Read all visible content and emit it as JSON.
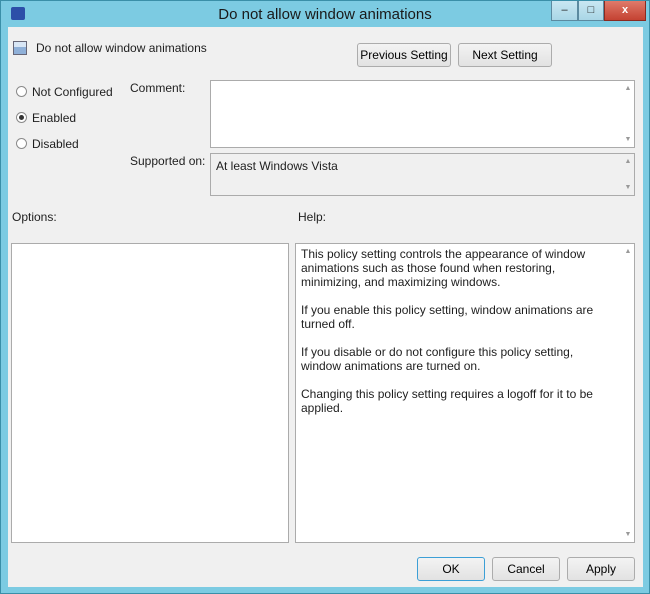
{
  "window": {
    "title": "Do not allow window animations",
    "minimize": "–",
    "maximize": "□",
    "close": "x"
  },
  "header": {
    "policy_name": "Do not allow window animations",
    "previous_label": "Previous Setting",
    "next_label": "Next Setting"
  },
  "state": {
    "options": [
      {
        "label": "Not Configured",
        "selected": false
      },
      {
        "label": "Enabled",
        "selected": true
      },
      {
        "label": "Disabled",
        "selected": false
      }
    ]
  },
  "comment": {
    "label": "Comment:",
    "value": ""
  },
  "supported": {
    "label": "Supported on:",
    "value": "At least Windows Vista"
  },
  "options_label": "Options:",
  "help": {
    "label": "Help:",
    "paragraphs": [
      "This policy setting controls the appearance of window animations such as those found when restoring, minimizing, and maximizing windows.",
      "If you enable this policy setting, window animations are turned off.",
      "If you disable or do not configure this policy setting, window animations are turned on.",
      "Changing this policy setting requires a logoff for it to be applied."
    ]
  },
  "footer": {
    "ok": "OK",
    "cancel": "Cancel",
    "apply": "Apply"
  }
}
